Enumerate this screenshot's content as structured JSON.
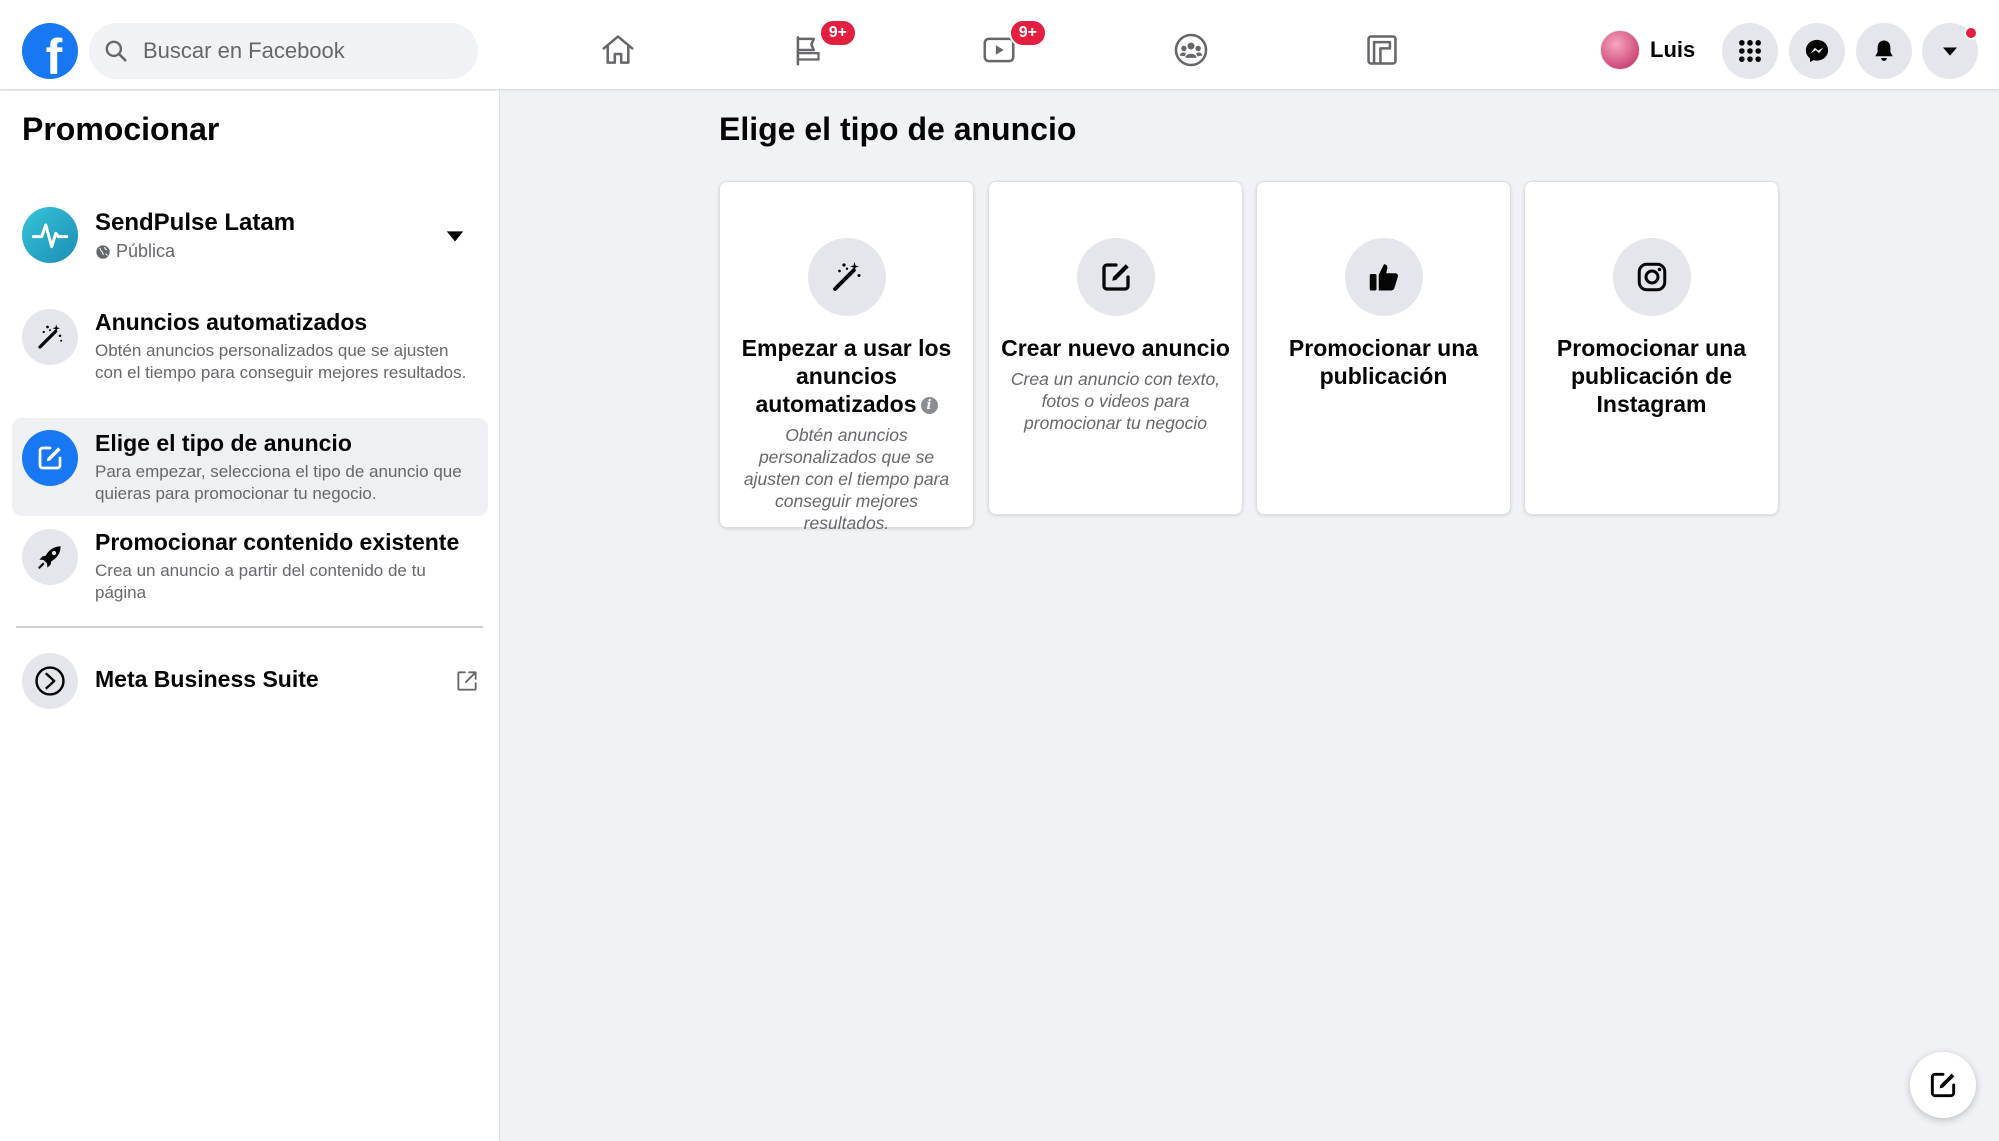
{
  "header": {
    "logo_letter": "f",
    "search_placeholder": "Buscar en Facebook",
    "nav": [
      {
        "name": "home",
        "badge": ""
      },
      {
        "name": "pages",
        "badge": "9+"
      },
      {
        "name": "watch",
        "badge": "9+"
      },
      {
        "name": "groups",
        "badge": ""
      },
      {
        "name": "gaming",
        "badge": ""
      }
    ],
    "profile_name": "Luis"
  },
  "sidebar": {
    "title": "Promocionar",
    "page": {
      "name": "SendPulse Latam",
      "visibility": "Pública"
    },
    "items": [
      {
        "label": "Anuncios automatizados",
        "desc": "Obtén anuncios personalizados que se ajusten con el tiempo para conseguir mejores resultados.",
        "icon": "magic-wand-icon",
        "active": false
      },
      {
        "label": "Elige el tipo de anuncio",
        "desc": "Para empezar, selecciona el tipo de anuncio que quieras para promocionar tu negocio.",
        "icon": "edit-square-icon",
        "active": true
      },
      {
        "label": "Promocionar contenido existente",
        "desc": "Crea un anuncio a partir del contenido de tu página",
        "icon": "rocket-icon",
        "active": false
      }
    ],
    "business_suite_label": "Meta Business Suite"
  },
  "main": {
    "title": "Elige el tipo de anuncio",
    "cards": [
      {
        "title": "Empezar a usar los anuncios automatizados",
        "desc": "Obtén anuncios personalizados que se ajusten con el tiempo para conseguir mejores resultados.",
        "icon": "magic-wand-icon"
      },
      {
        "title": "Crear nuevo anuncio",
        "desc": "Crea un anuncio con texto, fotos o videos para promocionar tu negocio",
        "icon": "edit-square-icon"
      },
      {
        "title": "Promocionar una publicación",
        "desc": "",
        "icon": "thumbs-up-icon"
      },
      {
        "title": "Promocionar una publicación de Instagram",
        "desc": "",
        "icon": "instagram-icon"
      }
    ]
  },
  "colors": {
    "brand": "#1877f2",
    "badge": "#e41e3f",
    "background": "#f0f2f5"
  }
}
